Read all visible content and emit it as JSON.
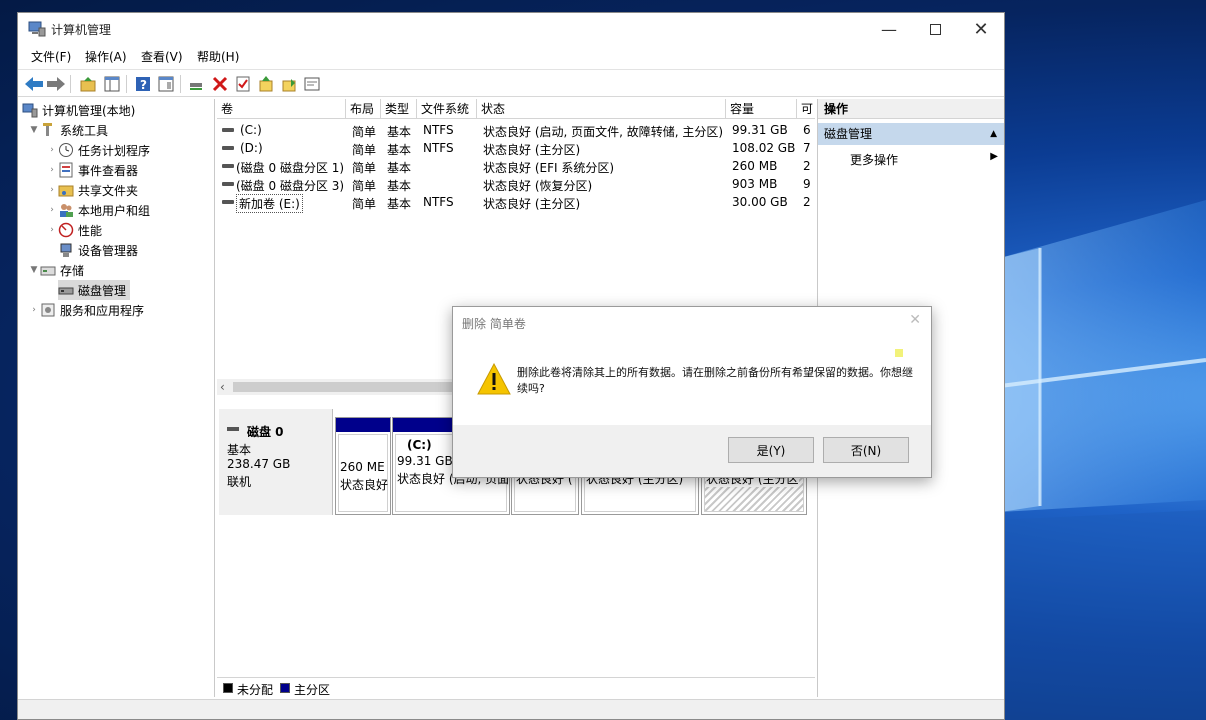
{
  "window": {
    "title": "计算机管理"
  },
  "menu": [
    "文件(F)",
    "操作(A)",
    "查看(V)",
    "帮助(H)"
  ],
  "toolbar": {
    "icons": [
      "back-icon",
      "forward-icon",
      "up-folder-icon",
      "show-hide-tree-icon",
      "help-icon",
      "properties-icon",
      "connect-drive-icon",
      "delete-icon",
      "check-icon",
      "import-icon",
      "export-icon",
      "console-icon"
    ]
  },
  "tree": {
    "root": "计算机管理(本地)",
    "system_tools": "系统工具",
    "task_scheduler": "任务计划程序",
    "event_viewer": "事件查看器",
    "shared_folders": "共享文件夹",
    "local_users": "本地用户和组",
    "performance": "性能",
    "device_manager": "设备管理器",
    "storage": "存储",
    "disk_management": "磁盘管理",
    "services": "服务和应用程序"
  },
  "volume_list": {
    "headers": [
      "卷",
      "布局",
      "类型",
      "文件系统",
      "状态",
      "容量",
      "可"
    ],
    "rows": [
      {
        "name": "(C:)",
        "layout": "简单",
        "type": "基本",
        "fs": "NTFS",
        "status": "状态良好 (启动, 页面文件, 故障转储, 主分区)",
        "capacity": "99.31 GB",
        "free": "6"
      },
      {
        "name": "(D:)",
        "layout": "简单",
        "type": "基本",
        "fs": "NTFS",
        "status": "状态良好 (主分区)",
        "capacity": "108.02 GB",
        "free": "7"
      },
      {
        "name": "(磁盘 0 磁盘分区 1)",
        "layout": "简单",
        "type": "基本",
        "fs": "",
        "status": "状态良好 (EFI 系统分区)",
        "capacity": "260 MB",
        "free": "2"
      },
      {
        "name": "(磁盘 0 磁盘分区 3)",
        "layout": "简单",
        "type": "基本",
        "fs": "",
        "status": "状态良好 (恢复分区)",
        "capacity": "903 MB",
        "free": "9"
      },
      {
        "name": "新加卷 (E:)",
        "layout": "简单",
        "type": "基本",
        "fs": "NTFS",
        "status": "状态良好 (主分区)",
        "capacity": "30.00 GB",
        "free": "2"
      }
    ]
  },
  "disk": {
    "name": "磁盘 0",
    "type": "基本",
    "size": "238.47 GB",
    "state": "联机",
    "partitions": [
      {
        "label": "",
        "size": "260 ME",
        "status": "状态良好"
      },
      {
        "label": "(C:)",
        "size": "99.31 GB",
        "status": "状态良好 (启动, 页面"
      },
      {
        "label": "",
        "size": "",
        "status": "状态良好 ("
      },
      {
        "label": "",
        "size": "",
        "status": "状态良好 (主分区)"
      },
      {
        "label": "",
        "size": "",
        "status": "状态良好 (主分区"
      }
    ]
  },
  "legend": [
    {
      "label": "未分配",
      "color": "#000000"
    },
    {
      "label": "主分区",
      "color": "#00008b"
    }
  ],
  "actions": {
    "header": "操作",
    "section": "磁盘管理",
    "more": "更多操作"
  },
  "dialog": {
    "title": "删除 简单卷",
    "message": "删除此卷将清除其上的所有数据。请在删除之前备份所有希望保留的数据。你想继续吗?",
    "yes": "是(Y)",
    "no": "否(N)"
  },
  "colors": {
    "primary_partition": "#00008b",
    "selected_section": "#c5d8ec",
    "warning": "#f5c400"
  }
}
